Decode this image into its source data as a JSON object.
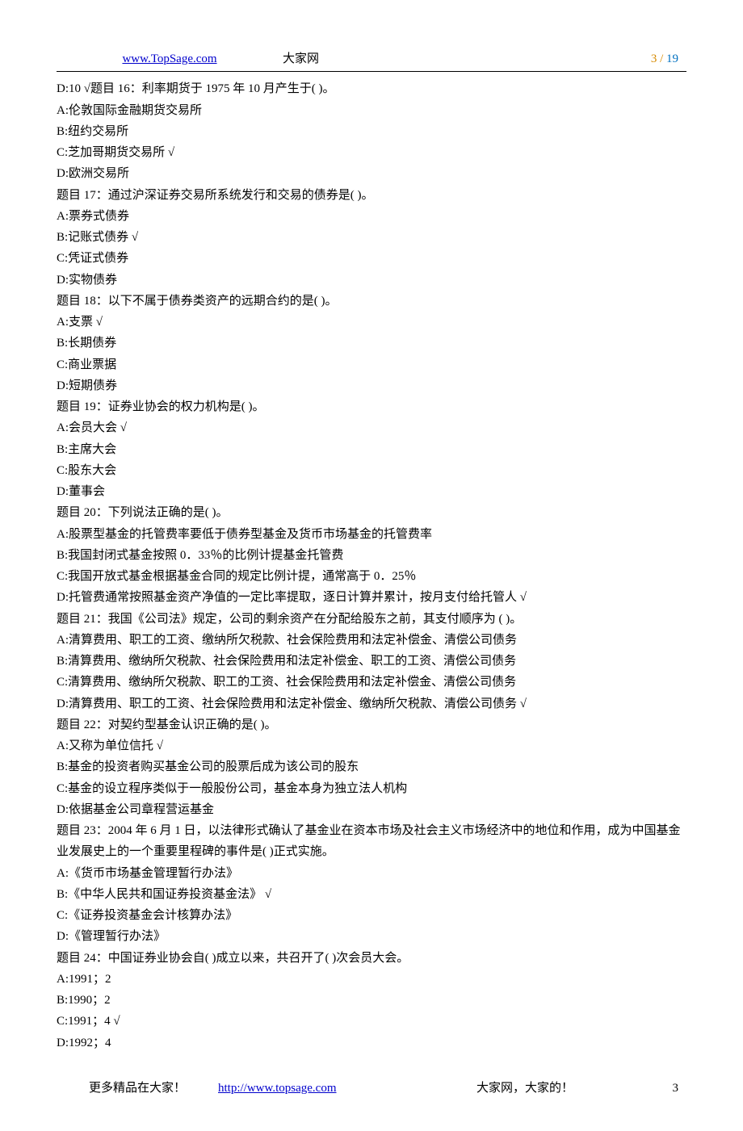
{
  "header": {
    "url": "www.TopSage.com",
    "site_name": "大家网",
    "page_current": "3",
    "page_sep": " / ",
    "page_total": "19"
  },
  "lines": [
    "D:10  √题目 16：利率期货于 1975 年 10 月产生于( )。",
    "A:伦敦国际金融期货交易所",
    "B:纽约交易所",
    "C:芝加哥期货交易所  √",
    "D:欧洲交易所",
    "题目 17：通过沪深证券交易所系统发行和交易的债券是( )。",
    "A:票券式债券",
    "B:记账式债券  √",
    "C:凭证式债券",
    "D:实物债券",
    "题目 18：以下不属于债券类资产的远期合约的是( )。",
    "A:支票  √",
    "B:长期债券",
    "C:商业票据",
    "D:短期债券",
    "题目 19：证券业协会的权力机构是( )。",
    "A:会员大会  √",
    "B:主席大会",
    "C:股东大会",
    "D:董事会",
    "题目 20：下列说法正确的是( )。",
    "A:股票型基金的托管费率要低于债券型基金及货币市场基金的托管费率",
    "B:我国封闭式基金按照 0．33％的比例计提基金托管费",
    "C:我国开放式基金根据基金合同的规定比例计提，通常高于 0．25％",
    "D:托管费通常按照基金资产净值的一定比率提取，逐日计算并累计，按月支付给托管人  √",
    "题目 21：我国《公司法》规定，公司的剩余资产在分配给股东之前，其支付顺序为 ( )。",
    "A:清算费用、职工的工资、缴纳所欠税款、社会保险费用和法定补偿金、清偿公司债务",
    "B:清算费用、缴纳所欠税款、社会保险费用和法定补偿金、职工的工资、清偿公司债务",
    "C:清算费用、缴纳所欠税款、职工的工资、社会保险费用和法定补偿金、清偿公司债务",
    "D:清算费用、职工的工资、社会保险费用和法定补偿金、缴纳所欠税款、清偿公司债务  √",
    "题目 22：对契约型基金认识正确的是( )。",
    "A:又称为单位信托  √",
    "B:基金的投资者购买基金公司的股票后成为该公司的股东",
    "C:基金的设立程序类似于一般股份公司，基金本身为独立法人机构",
    "D:依据基金公司章程营运基金",
    "题目 23：2004 年 6 月 1 日，以法律形式确认了基金业在资本市场及社会主义市场经济中的地位和作用，成为中国基金业发展史上的一个重要里程碑的事件是( )正式实施。",
    "A:《货币市场基金管理暂行办法》",
    "B:《中华人民共和国证券投资基金法》  √",
    "C:《证券投资基金会计核算办法》",
    "D:《管理暂行办法》",
    "题目 24：中国证券业协会自( )成立以来，共召开了( )次会员大会。",
    "A:1991；2",
    "B:1990；2",
    "C:1991；4  √",
    "D:1992；4"
  ],
  "footer": {
    "left": "更多精品在大家！",
    "url": "http://www.topsage.com",
    "right": "大家网，大家的！",
    "page": "3"
  }
}
